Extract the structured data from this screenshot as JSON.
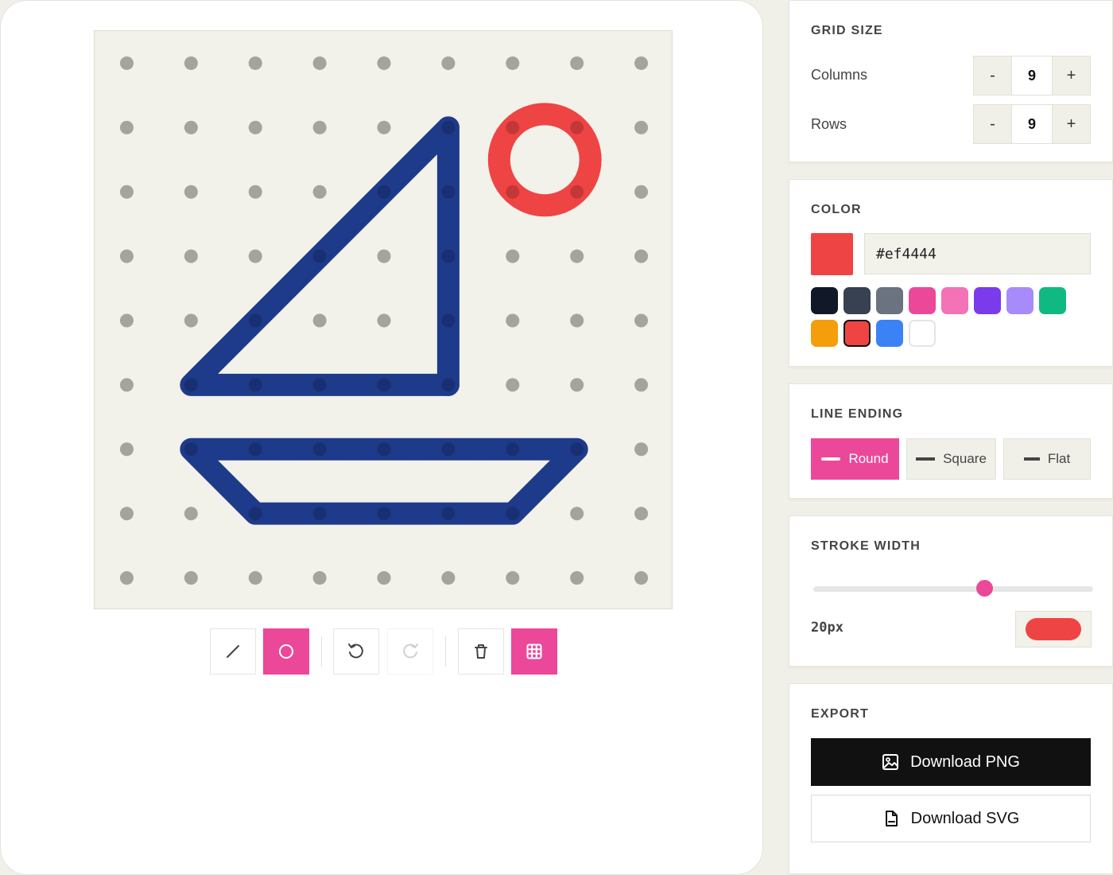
{
  "grid_size": {
    "title": "GRID SIZE",
    "columns": {
      "label": "Columns",
      "value": 9,
      "dec": "-",
      "inc": "+"
    },
    "rows": {
      "label": "Rows",
      "value": 9,
      "dec": "-",
      "inc": "+"
    }
  },
  "color": {
    "title": "COLOR",
    "current": "#ef4444",
    "hex_value": "#ef4444",
    "palette": [
      "#111827",
      "#374151",
      "#6b7280",
      "#ec4899",
      "#f472b6",
      "#7c3aed",
      "#a78bfa",
      "#10b981",
      "#f59e0b",
      "#ef4444",
      "#3b82f6",
      "#ffffff"
    ],
    "selected_index": 9
  },
  "line_ending": {
    "title": "LINE ENDING",
    "options": [
      "Round",
      "Square",
      "Flat"
    ],
    "selected": "Round"
  },
  "stroke_width": {
    "title": "STROKE WIDTH",
    "value": 20,
    "min": 1,
    "max": 32,
    "readout": "20px"
  },
  "export": {
    "title": "EXPORT",
    "png_label": "Download PNG",
    "svg_label": "Download SVG"
  },
  "toolbar": {
    "tools": [
      {
        "name": "line-tool",
        "icon": "line-icon",
        "active": false,
        "disabled": false
      },
      {
        "name": "circle-tool",
        "icon": "circle-icon",
        "active": true,
        "disabled": false
      },
      {
        "name": "undo-button",
        "icon": "undo-icon",
        "active": false,
        "disabled": false
      },
      {
        "name": "redo-button",
        "icon": "redo-icon",
        "active": false,
        "disabled": true
      },
      {
        "name": "clear-button",
        "icon": "trash-icon",
        "active": false,
        "disabled": false
      },
      {
        "name": "grid-toggle",
        "icon": "grid-icon",
        "active": true,
        "disabled": false
      }
    ]
  },
  "accent_color": "#ec4899",
  "drawing": {
    "dot_color": "#c8c7c0",
    "shapes": [
      {
        "type": "polyline",
        "color": "#1e3a8a",
        "points": [
          [
            5,
            1
          ],
          [
            5,
            5
          ]
        ]
      },
      {
        "type": "polyline",
        "color": "#1e3a8a",
        "points": [
          [
            5,
            1
          ],
          [
            1,
            5
          ],
          [
            5,
            5
          ]
        ]
      },
      {
        "type": "polyline",
        "color": "#1e3a8a",
        "points": [
          [
            1,
            6
          ],
          [
            7,
            6
          ],
          [
            6,
            7
          ],
          [
            2,
            7
          ],
          [
            1,
            6
          ]
        ]
      },
      {
        "type": "circle",
        "color": "#ef4444",
        "center": [
          6.5,
          1.5
        ],
        "radius_cells": 0.71
      }
    ]
  }
}
